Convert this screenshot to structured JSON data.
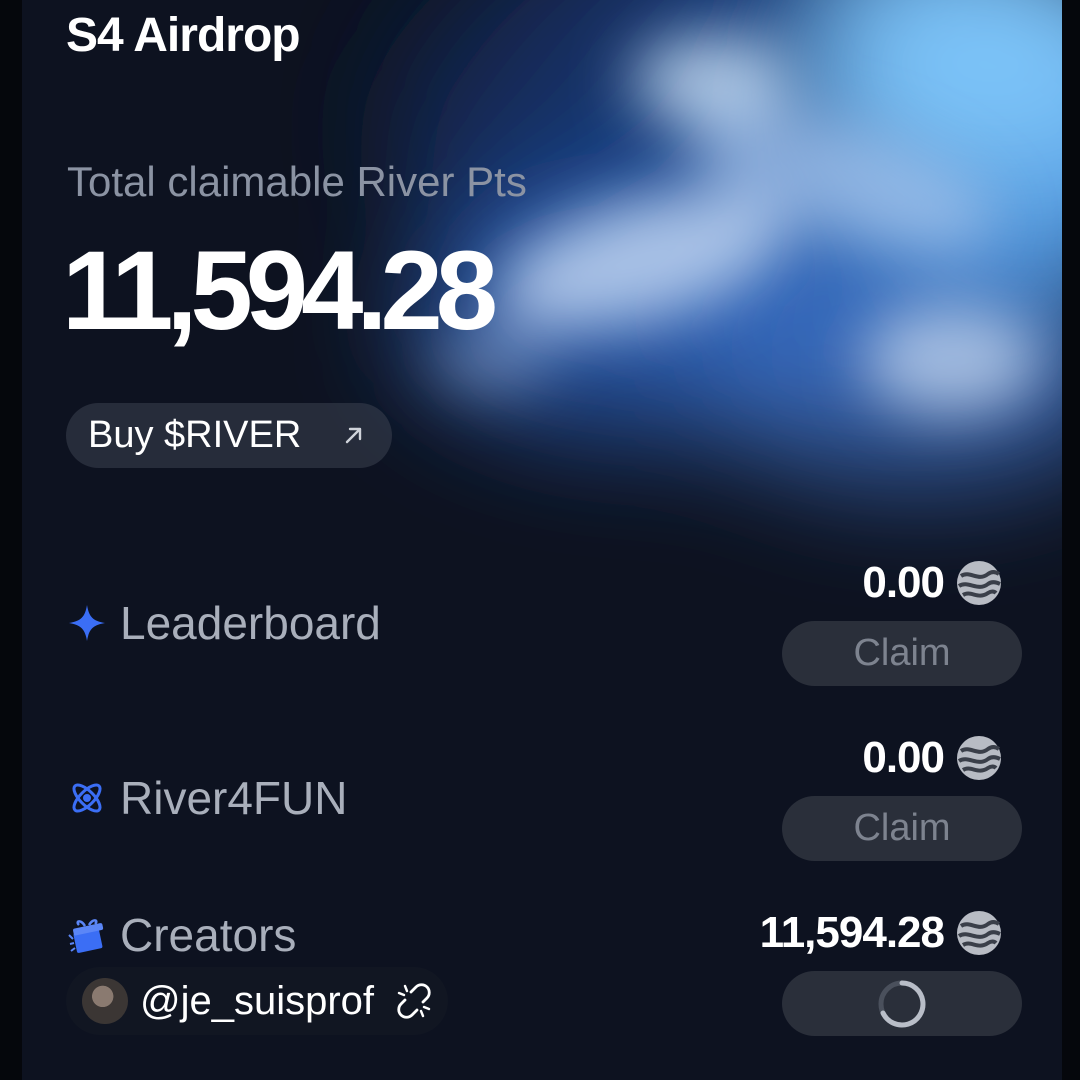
{
  "header": {
    "title": "S4 Airdrop"
  },
  "summary": {
    "label": "Total claimable River Pts",
    "total": "11,594.28",
    "buy_button": "Buy $RIVER",
    "buy_icon": "arrow-up-right-icon"
  },
  "rows": [
    {
      "label": "Leaderboard",
      "icon": "sparkle-icon",
      "amount": "0.00",
      "button": "Claim",
      "state": "disabled"
    },
    {
      "label": "River4FUN",
      "icon": "atom-icon",
      "amount": "0.00",
      "button": "Claim",
      "state": "disabled"
    },
    {
      "label": "Creators",
      "icon": "gift-icon",
      "amount": "11,594.28",
      "button": "",
      "state": "loading"
    }
  ],
  "creator": {
    "handle": "@je_suisprof",
    "link_icon": "unlink-icon"
  },
  "colors": {
    "background": "#0d1220",
    "accent": "#3b6ef5",
    "button_bg": "#2a2f3a",
    "muted_text": "#8b93a3"
  }
}
